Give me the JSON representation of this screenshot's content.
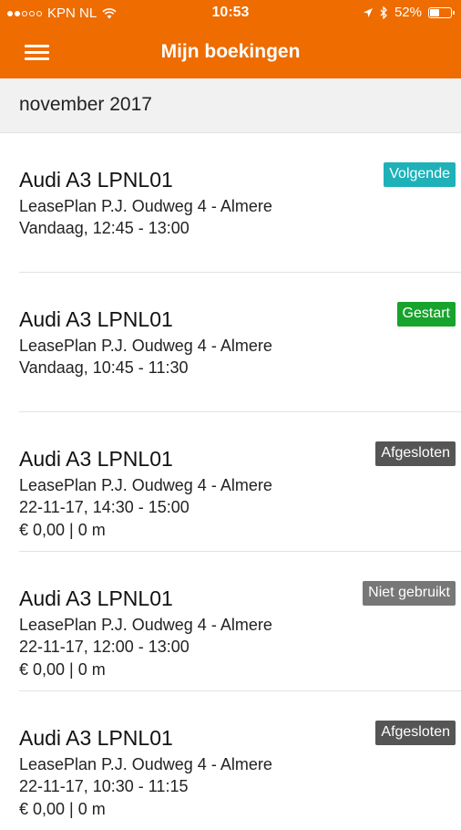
{
  "status_bar": {
    "carrier": "KPN NL",
    "time": "10:53",
    "battery": "52%",
    "battery_level": 0.52,
    "icons": [
      "signal-dots-icon",
      "wifi-icon",
      "location-arrow-icon",
      "bluetooth-icon",
      "battery-icon"
    ]
  },
  "nav": {
    "title": "Mijn boekingen",
    "menu_icon": "hamburger-menu-icon"
  },
  "section": {
    "month": "november 2017"
  },
  "colors": {
    "brand_orange": "#ee6c00",
    "badge_next": "#1eb1b8",
    "badge_started": "#18a32d",
    "badge_closed": "#555555",
    "badge_unused": "#777777"
  },
  "bookings": [
    {
      "car": "Audi A3 LPNL01",
      "location": "LeasePlan P.J. Oudweg 4 - Almere",
      "time": "Vandaag, 12:45 - 13:00",
      "cost": "",
      "status": "Volgende",
      "status_color": "#1eb1b8"
    },
    {
      "car": "Audi A3 LPNL01",
      "location": "LeasePlan P.J. Oudweg 4 - Almere",
      "time": "Vandaag, 10:45 - 11:30",
      "cost": "",
      "status": "Gestart",
      "status_color": "#18a32d"
    },
    {
      "car": "Audi A3 LPNL01",
      "location": "LeasePlan P.J. Oudweg 4 - Almere",
      "time": "22-11-17, 14:30 - 15:00",
      "cost": "€ 0,00 | 0 m",
      "status": "Afgesloten",
      "status_color": "#555555"
    },
    {
      "car": "Audi A3 LPNL01",
      "location": "LeasePlan P.J. Oudweg 4 - Almere",
      "time": "22-11-17, 12:00 - 13:00",
      "cost": "€ 0,00 | 0 m",
      "status": "Niet gebruikt",
      "status_color": "#777777"
    },
    {
      "car": "Audi A3 LPNL01",
      "location": "LeasePlan P.J. Oudweg 4 - Almere",
      "time": "22-11-17, 10:30 - 11:15",
      "cost": "€ 0,00 | 0 m",
      "status": "Afgesloten",
      "status_color": "#555555"
    }
  ]
}
